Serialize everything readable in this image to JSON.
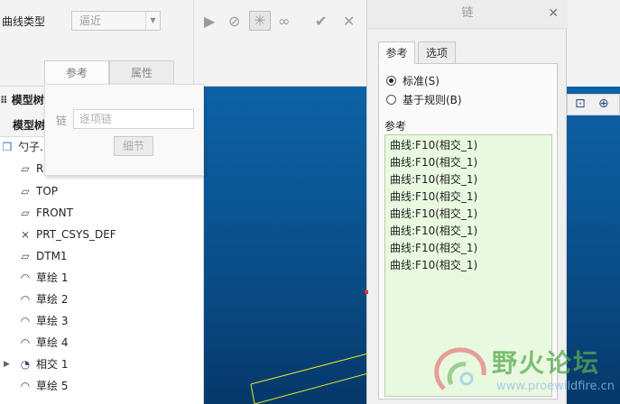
{
  "ribbon": {
    "curve_type_label": "曲线类型",
    "curve_type_value": "逼近",
    "tabs": [
      {
        "label": "参考",
        "active": true
      },
      {
        "label": "属性",
        "active": false
      }
    ],
    "tools": [
      "play-icon",
      "stop-icon",
      "verify-icon",
      "glasses-icon",
      "check-icon",
      "cancel-icon"
    ]
  },
  "ref_panel": {
    "chain_label": "链",
    "chain_placeholder": "逐项链",
    "details_label": "细节"
  },
  "model_tree": {
    "title": "模型树",
    "subtitle": "模型树",
    "items": [
      {
        "label": "勺子.PRT",
        "icon": "part-icon"
      },
      {
        "label": "RIGHT",
        "icon": "plane-icon"
      },
      {
        "label": "TOP",
        "icon": "plane-icon"
      },
      {
        "label": "FRONT",
        "icon": "plane-icon"
      },
      {
        "label": "PRT_CSYS_DEF",
        "icon": "csys-icon"
      },
      {
        "label": "DTM1",
        "icon": "plane-icon"
      },
      {
        "label": "草绘 1",
        "icon": "sketch-icon"
      },
      {
        "label": "草绘 2",
        "icon": "sketch-icon"
      },
      {
        "label": "草绘 3",
        "icon": "sketch-icon"
      },
      {
        "label": "草绘 4",
        "icon": "sketch-icon"
      },
      {
        "label": "相交 1",
        "icon": "intersect-icon",
        "expandable": true
      },
      {
        "label": "草绘 5",
        "icon": "sketch-icon"
      }
    ]
  },
  "chain_dialog": {
    "title": "链",
    "tabs": [
      {
        "label": "参考",
        "active": true
      },
      {
        "label": "选项",
        "active": false
      }
    ],
    "options": [
      {
        "label": "标准(S)",
        "selected": true
      },
      {
        "label": "基于规则(B)",
        "selected": false
      }
    ],
    "references_title": "参考",
    "references": [
      "曲线:F10(相交_1)",
      "曲线:F10(相交_1)",
      "曲线:F10(相交_1)",
      "曲线:F10(相交_1)",
      "曲线:F10(相交_1)",
      "曲线:F10(相交_1)",
      "曲线:F10(相交_1)",
      "曲线:F10(相交_1)"
    ]
  },
  "watermark": {
    "text": "野火论坛",
    "url": "www.proewildfire.cn"
  },
  "colors": {
    "viewport_top": "#0d62a6",
    "viewport_bottom": "#06386a",
    "reference_list_bg": "#e8f9e0",
    "curve_yellow": "#e6e62a"
  }
}
